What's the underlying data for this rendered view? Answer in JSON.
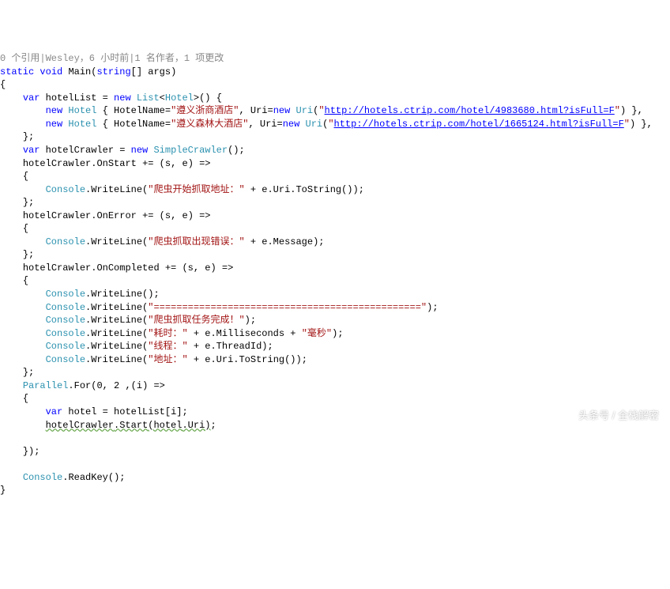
{
  "codelens": "0 个引用|Wesley，6 小时前|1 名作者，1 项更改",
  "kw": {
    "static": "static",
    "void": "void",
    "string": "string",
    "var": "var",
    "new": "new"
  },
  "id": {
    "Main": "Main",
    "args": "args",
    "hotelList": "hotelList",
    "hotelCrawler": "hotelCrawler",
    "hotel": "hotel",
    "s": "s",
    "e": "e",
    "i": "i"
  },
  "type": {
    "List": "List",
    "Hotel": "Hotel",
    "Uri": "Uri",
    "SimpleCrawler": "SimpleCrawler",
    "Console": "Console",
    "Parallel": "Parallel"
  },
  "member": {
    "HotelName": "HotelName",
    "UriProp": "Uri",
    "OnStart": "OnStart",
    "OnError": "OnError",
    "OnCompleted": "OnCompleted",
    "WriteLine": "WriteLine",
    "ReadKey": "ReadKey",
    "For": "For",
    "Start": "Start",
    "ToString": "ToString",
    "Message": "Message",
    "Milliseconds": "Milliseconds",
    "ThreadId": "ThreadId"
  },
  "str": {
    "hotel1Name": "\"遵义浙商酒店\"",
    "hotel2Name": "\"遵义森林大酒店\"",
    "url1a": "\"",
    "url1b": "http://hotels.ctrip.com/hotel/4983680.html?isFull=F",
    "url1c": "\"",
    "url2a": "\"",
    "url2b": "http://hotels.ctrip.com/hotel/1665124.html?isFull=F",
    "url2c": "\"",
    "crawlStart": "\"爬虫开始抓取地址：\"",
    "crawlError": "\"爬虫抓取出现错误：\"",
    "sep": "\"===============================================\"",
    "done": "\"爬虫抓取任务完成！\"",
    "elapsedA": "\"耗时：\"",
    "elapsedB": "\"毫秒\"",
    "thread": "\"线程：\"",
    "addr": "\"地址：\""
  },
  "sym": {
    "lbrace": "{",
    "rbrace": "}",
    "lparen": "(",
    "rparen": ")",
    "lbrack": "[",
    "rbrack": "]",
    "lt": "<",
    "gt": ">",
    "semi": ";",
    "comma": ",",
    "dot": ".",
    "eq": "=",
    "pluseq": "+=",
    "plus": " + ",
    "arrow": " =>",
    "zero": "0",
    "two": "2"
  },
  "watermark": "头条号 / 全栈解密"
}
